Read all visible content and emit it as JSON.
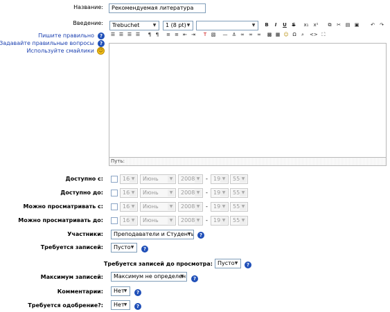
{
  "form": {
    "name": {
      "label": "Название:",
      "value": "Рекомендуемая литература"
    },
    "intro": {
      "label": "Введение:"
    },
    "help_links": {
      "write_well": "Пишите правильно",
      "ask_good_questions": "Задавайте правильные вопросы",
      "use_smileys": "Используйте смайлики"
    },
    "toolbar": {
      "font": "Trebuchet",
      "size": "1 (8 pt)",
      "format": "",
      "row1_icons": [
        "bold-icon",
        "italic-icon",
        "underline-icon",
        "strikethrough-icon",
        "subscript-icon",
        "superscript-icon",
        "copy-icon",
        "cut-icon",
        "paste-icon",
        "clean-icon",
        "undo-icon",
        "redo-icon"
      ],
      "row2_icons": [
        "align-left-icon",
        "align-center-icon",
        "align-right-icon",
        "justify-icon",
        "ltr-icon",
        "rtl-icon",
        "ordered-list-icon",
        "unordered-list-icon",
        "outdent-icon",
        "indent-icon",
        "text-color-icon",
        "bg-color-icon",
        "hr-icon",
        "anchor-icon",
        "link-icon",
        "unlink-icon",
        "nolink-icon",
        "image-icon",
        "table-icon",
        "smiley-icon",
        "special-char-icon",
        "search-replace-icon",
        "html-source-icon",
        "fullscreen-icon"
      ]
    },
    "editor_path": "Путь:",
    "date_rows": [
      {
        "label": "Доступно с:",
        "day": "16",
        "month": "Июнь",
        "year": "2008",
        "hour": "19",
        "minute": "55"
      },
      {
        "label": "Доступно до:",
        "day": "16",
        "month": "Июнь",
        "year": "2008",
        "hour": "19",
        "minute": "55"
      },
      {
        "label": "Можно просматривать с:",
        "day": "16",
        "month": "Июнь",
        "year": "2008",
        "hour": "19",
        "minute": "55"
      },
      {
        "label": "Можно просматривать до:",
        "day": "16",
        "month": "Июнь",
        "year": "2008",
        "hour": "19",
        "minute": "55"
      }
    ],
    "participants": {
      "label": "Участники:",
      "value": "Преподаватели и Студенты"
    },
    "entries_required": {
      "label": "Требуется записей:",
      "value": "Пусто"
    },
    "entries_to_view": {
      "label": "Требуется записей до просмотра:",
      "value": "Пусто"
    },
    "max_entries": {
      "label": "Максимум записей:",
      "value": "Максимум не определен"
    },
    "comments": {
      "label": "Комментарии:",
      "value": "Нет"
    },
    "approval": {
      "label": "Требуется одобрение?:",
      "value": "Нет"
    },
    "dash": "-"
  }
}
